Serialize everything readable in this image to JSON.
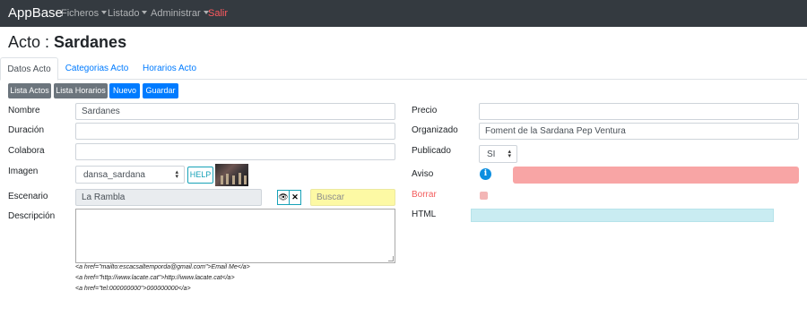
{
  "navbar": {
    "brand": "AppBase",
    "items": [
      {
        "label": "Ficheros"
      },
      {
        "label": "Listado"
      },
      {
        "label": "Administrar"
      },
      {
        "label": "Salir"
      }
    ]
  },
  "page": {
    "title_prefix": "Acto : ",
    "title_name": "Sardanes"
  },
  "tabs": [
    {
      "label": "Datos Acto"
    },
    {
      "label": "Categorias Acto"
    },
    {
      "label": "Horarios Acto"
    }
  ],
  "toolbar": {
    "lista_actos": "Lista Actos",
    "lista_horarios": "Lista Horarios",
    "nuevo": "Nuevo",
    "guardar": "Guardar"
  },
  "form": {
    "nombre": {
      "label": "Nombre",
      "value": "Sardanes"
    },
    "duracion": {
      "label": "Duración",
      "value": ""
    },
    "colabora": {
      "label": "Colabora",
      "value": ""
    },
    "imagen": {
      "label": "Imagen",
      "value": "dansa_sardana",
      "help": "HELP"
    },
    "escenario": {
      "label": "Escenario",
      "value": "La Rambla",
      "search_placeholder": "Buscar"
    },
    "descripcion": {
      "label": "Descripción",
      "value": ""
    },
    "precio": {
      "label": "Precio",
      "value": ""
    },
    "organizado": {
      "label": "Organizado",
      "value": "Foment de la Sardana Pep Ventura"
    },
    "publicado": {
      "label": "Publicado",
      "value": "SI"
    },
    "aviso": {
      "label": "Aviso"
    },
    "borrar": {
      "label": "Borrar"
    },
    "html": {
      "label": "HTML"
    }
  },
  "snippets": [
    "<a href=\"mailto:escacsaltemporda@gmail.com\">Email Me</a>",
    "<a href=\"http://www.lacate.cat\">http://www.lacate.cat</a>",
    "<a href=\"tel:000000000\">000000000</a>"
  ],
  "colors": {
    "navbar": "#343a40",
    "primary": "#007bff",
    "secondary": "#6c757d",
    "danger": "#dc3545",
    "info": "#17a2b8"
  }
}
